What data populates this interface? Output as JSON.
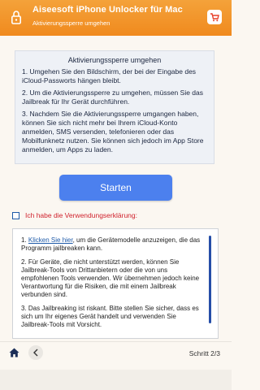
{
  "window": {
    "app_title": "Aiseesoft iPhone Unlocker für Mac",
    "subtitle": "Aktivierungssperre umgehen"
  },
  "intro": {
    "title": "Aktivierungssperre umgehen",
    "steps": [
      "1. Umgehen Sie den Bildschirm, der bei der Eingabe des iCloud-Passworts hängen bleibt.",
      "2. Um die Aktivierungssperre zu umgehen, müssen Sie das Jailbreak für Ihr Gerät durchführen.",
      "3. Nachdem Sie die Aktivierungssperre umgangen haben, können Sie sich nicht mehr bei Ihrem iCloud-Konto anmelden, SMS versenden, telefonieren oder das Mobilfunknetz nutzen. Sie können sich jedoch im App Store anmelden, um Apps zu laden."
    ]
  },
  "start_button": {
    "label": "Starten"
  },
  "agreement": {
    "label": "Ich habe die Verwendungserklärung:"
  },
  "terms": {
    "item1_prefix": "1. ",
    "item1_link": "Klicken Sie hier",
    "item1_suffix": ", um die Gerätemodelle anzuzeigen, die das Programm jailbreaken kann.",
    "item2": "2. Für Geräte, die nicht unterstützt werden, können Sie Jailbreak-Tools von Drittanbietern oder die von uns empfohlenen Tools verwenden. Wir übernehmen jedoch keine Verantwortung für die Risiken, die mit einem Jailbreak verbunden sind.",
    "item3": "3. Das Jailbreaking ist riskant. Bitte stellen Sie sicher, dass es sich um Ihr eigenes Gerät handelt und verwenden Sie Jailbreak-Tools mit Vorsicht."
  },
  "footer": {
    "step": "Schritt 2/3"
  },
  "colors": {
    "titlebar": "#f08a1e",
    "primary_button": "#4c80ee",
    "warning_text": "#d0222d",
    "link": "#1e5aa8"
  },
  "icons": [
    "lock-icon",
    "cart-icon",
    "home-icon",
    "chevron-left-icon"
  ]
}
